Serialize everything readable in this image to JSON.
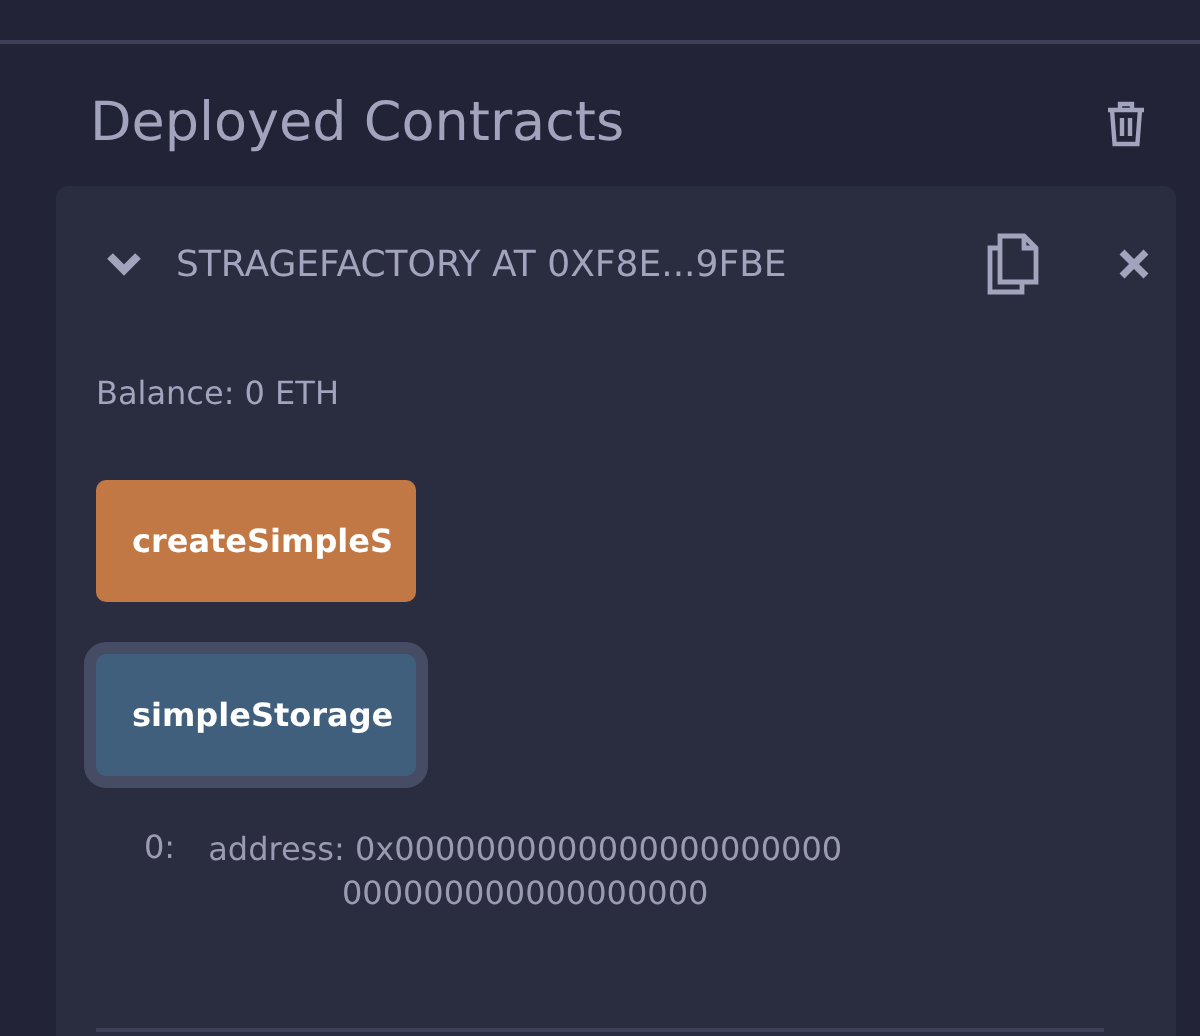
{
  "section": {
    "title": "Deployed Contracts"
  },
  "contract": {
    "title": "STRAGEFACTORY AT 0XF8E...9FBE",
    "expanded": true,
    "balance": "Balance: 0 ETH",
    "functions": [
      {
        "label": "createSimpleS",
        "kind": "transact",
        "focused": false
      },
      {
        "label": "simpleStorage",
        "kind": "call",
        "focused": true
      }
    ],
    "output": {
      "index": "0:",
      "text": "address: 0x0000000000000000000000 000000000000000000"
    }
  }
}
